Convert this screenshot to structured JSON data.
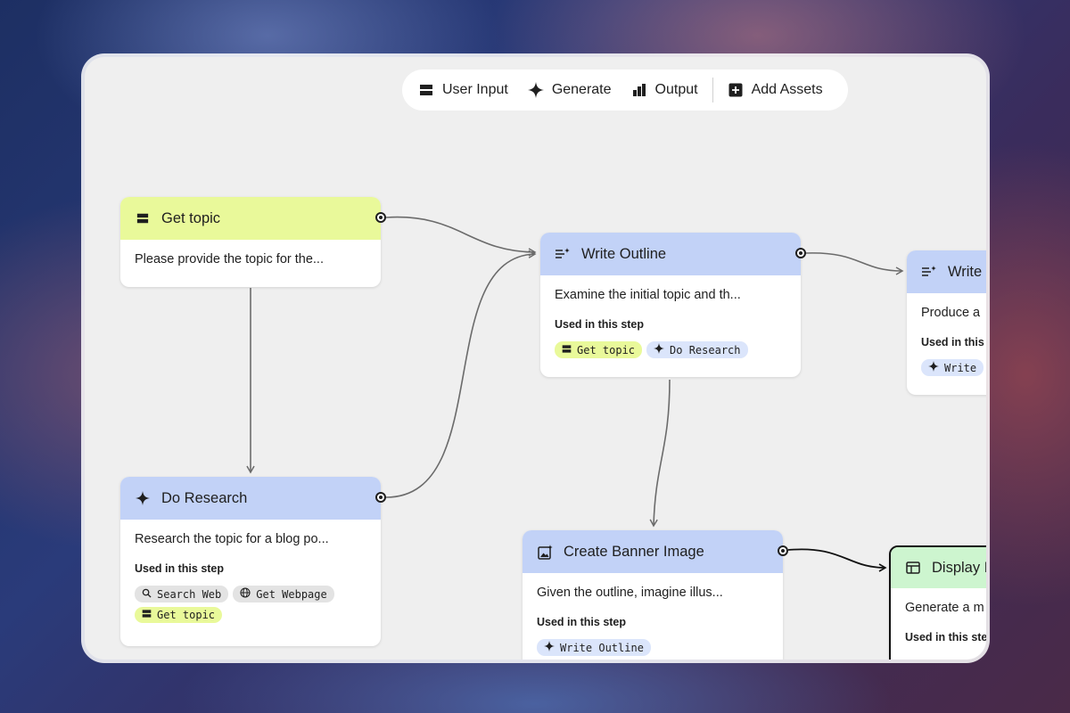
{
  "toolbar": {
    "user_input": "User Input",
    "generate": "Generate",
    "output": "Output",
    "add_assets": "Add Assets"
  },
  "nodes": {
    "get_topic": {
      "title": "Get topic",
      "description": "Please provide the topic for the..."
    },
    "do_research": {
      "title": "Do Research",
      "description": "Research the topic for a blog po...",
      "used_label": "Used in this step",
      "chips": [
        "Search Web",
        "Get Webpage",
        "Get topic"
      ]
    },
    "write_outline": {
      "title": "Write Outline",
      "description": "Examine the initial topic and th...",
      "used_label": "Used in this step",
      "chips": [
        "Get topic",
        "Do Research"
      ]
    },
    "create_banner": {
      "title": "Create Banner Image",
      "description": "Given the outline, imagine illus...",
      "used_label": "Used in this step",
      "chips": [
        "Write Outline"
      ]
    },
    "write_partial": {
      "title": "Write",
      "description": "Produce a",
      "used_label": "Used in this",
      "chips": [
        "Write"
      ]
    },
    "display_partial": {
      "title": "Display I",
      "description": "Generate a m",
      "used_label": "Used in this ste"
    }
  },
  "colors": {
    "input_header": "#e9f99a",
    "generate_header": "#c2d2f7",
    "output_header": "#cdf5cf",
    "canvas": "#efefef"
  },
  "icons": [
    "user-input-icon",
    "generate-sparkle-icon",
    "output-icon",
    "add-assets-icon",
    "outline-icon",
    "search-icon",
    "globe-icon",
    "image-icon",
    "display-icon"
  ]
}
